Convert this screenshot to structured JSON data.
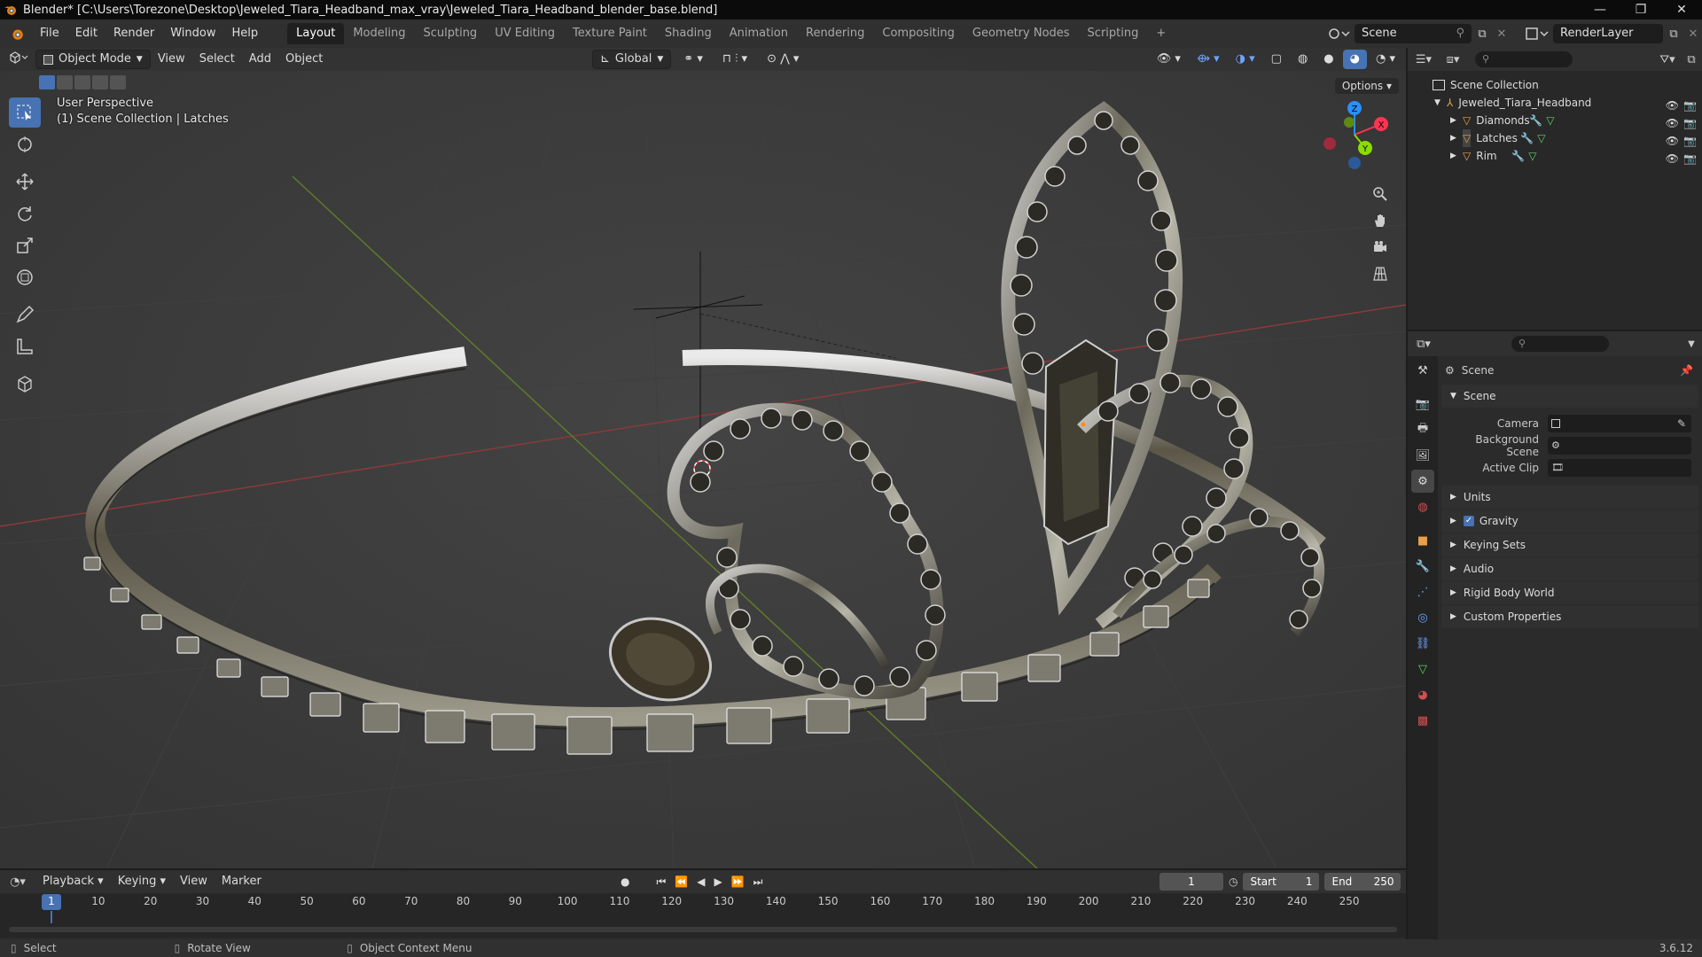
{
  "window": {
    "title": "Blender* [C:\\Users\\Torezone\\Desktop\\Jeweled_Tiara_Headband_max_vray\\Jeweled_Tiara_Headband_blender_base.blend]"
  },
  "menu": [
    "File",
    "Edit",
    "Render",
    "Window",
    "Help"
  ],
  "workspaces": [
    {
      "label": "Layout",
      "active": true
    },
    {
      "label": "Modeling"
    },
    {
      "label": "Sculpting"
    },
    {
      "label": "UV Editing"
    },
    {
      "label": "Texture Paint"
    },
    {
      "label": "Shading"
    },
    {
      "label": "Animation"
    },
    {
      "label": "Rendering"
    },
    {
      "label": "Compositing"
    },
    {
      "label": "Geometry Nodes"
    },
    {
      "label": "Scripting"
    }
  ],
  "topright": {
    "scene": "Scene",
    "view_layer": "RenderLayer"
  },
  "viewport": {
    "mode": "Object Mode",
    "menus": [
      "View",
      "Select",
      "Add",
      "Object"
    ],
    "transform_orientation": "Global",
    "options_label": "Options",
    "perspective": "User Perspective",
    "collection_info": "(1) Scene Collection | Latches",
    "gizmo": {
      "x": "X",
      "y": "Y",
      "z": "Z"
    }
  },
  "outliner": {
    "root": "Scene Collection",
    "collection": "Jeweled_Tiara_Headband",
    "objects": [
      "Diamonds",
      "Latches",
      "Rim"
    ]
  },
  "properties": {
    "context": "Scene",
    "panel_title": "Scene",
    "fields": [
      {
        "label": "Camera",
        "value": ""
      },
      {
        "label": "Background Scene",
        "value": ""
      },
      {
        "label": "Active Clip",
        "value": ""
      }
    ],
    "subpanels": [
      "Units",
      "Gravity",
      "Keying Sets",
      "Audio",
      "Rigid Body World",
      "Custom Properties"
    ],
    "gravity_checked": true
  },
  "timeline": {
    "menus": [
      "Playback",
      "Keying",
      "View",
      "Marker"
    ],
    "current_frame": "1",
    "start_label": "Start",
    "start": "1",
    "end_label": "End",
    "end": "250",
    "ticks": [
      "1",
      "10",
      "20",
      "30",
      "40",
      "50",
      "60",
      "70",
      "80",
      "90",
      "100",
      "110",
      "120",
      "130",
      "140",
      "150",
      "160",
      "170",
      "180",
      "190",
      "200",
      "210",
      "220",
      "230",
      "240",
      "250"
    ]
  },
  "statusbar": {
    "select": "Select",
    "rotate": "Rotate View",
    "context_menu": "Object Context Menu",
    "version": "3.6.12"
  },
  "colors": {
    "accent": "#4772b3",
    "axis_x": "#ff3352",
    "axis_y": "#8bdc00",
    "axis_z": "#2890ff"
  }
}
